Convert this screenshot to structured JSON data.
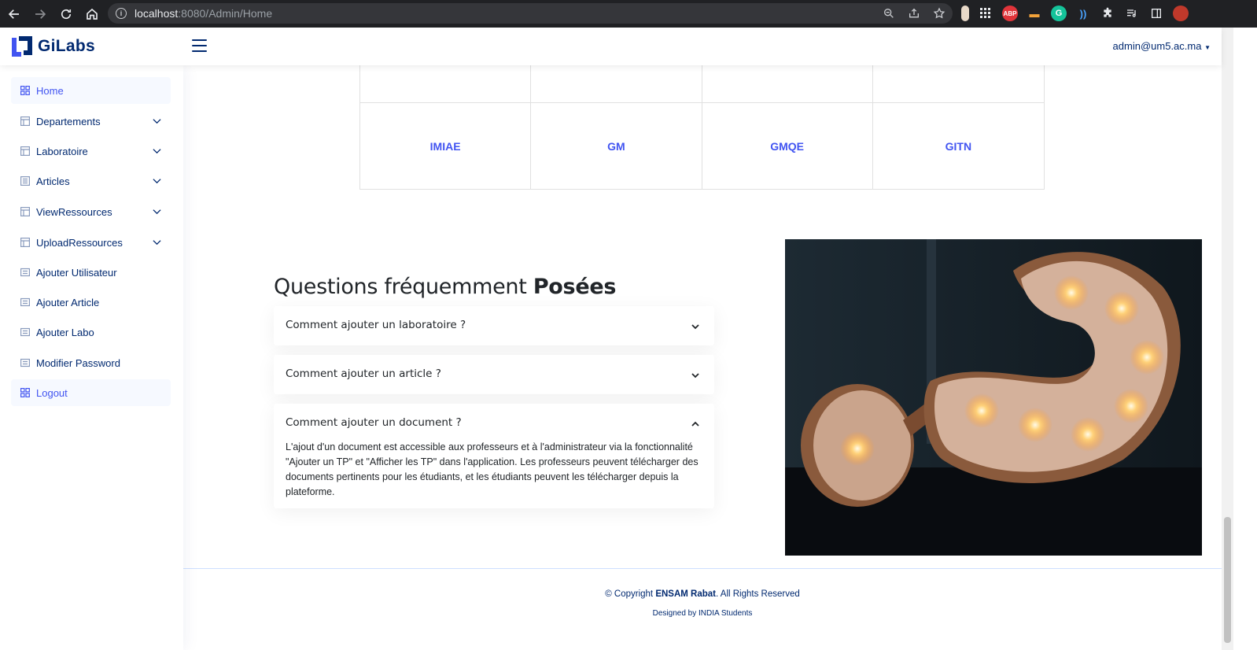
{
  "browser": {
    "url_host": "localhost",
    "url_path": ":8080/Admin/Home"
  },
  "header": {
    "logo_text": "GiLabs",
    "user": "admin@um5.ac.ma"
  },
  "sidebar": {
    "items": [
      {
        "label": "Home",
        "icon": "grid-icon",
        "active": true
      },
      {
        "label": "Departements",
        "icon": "layout-icon",
        "expandable": true
      },
      {
        "label": "Laboratoire",
        "icon": "layout-icon",
        "expandable": true
      },
      {
        "label": "Articles",
        "icon": "journal-icon",
        "expandable": true
      },
      {
        "label": "ViewRessources",
        "icon": "layout-icon",
        "expandable": true
      },
      {
        "label": "UploadRessources",
        "icon": "layout-icon",
        "expandable": true
      },
      {
        "label": "Ajouter Utilisateur",
        "icon": "card-list-icon"
      },
      {
        "label": "Ajouter Article",
        "icon": "card-list-icon"
      },
      {
        "label": "Ajouter Labo",
        "icon": "card-list-icon"
      },
      {
        "label": "Modifier Password",
        "icon": "card-list-icon"
      },
      {
        "label": "Logout",
        "icon": "grid-icon",
        "active": true
      }
    ]
  },
  "departments": [
    "IMIAE",
    "GM",
    "GMQE",
    "GITN"
  ],
  "faq": {
    "title_prefix": "Questions fréquemment",
    "title_bold": "Posées",
    "items": [
      {
        "question": "Comment ajouter un laboratoire ?",
        "expanded": false
      },
      {
        "question": "Comment ajouter un article ?",
        "expanded": false
      },
      {
        "question": "Comment ajouter un document ?",
        "expanded": true,
        "answer": "L'ajout d'un document est accessible aux professeurs et à l'administrateur via la fonctionnalité \"Ajouter un TP\" et \"Afficher les TP\" dans l'application. Les professeurs peuvent télécharger des documents pertinents pour les étudiants, et les étudiants peuvent les télécharger depuis la plateforme."
      }
    ]
  },
  "footer": {
    "copyright_prefix": "© Copyright",
    "copyright_org": "ENSAM Rabat",
    "copyright_suffix": ". All Rights Reserved",
    "credits": "Designed by INDIA Students"
  },
  "colors": {
    "primary": "#4154f1",
    "navy": "#012970",
    "browser": "#202124"
  }
}
